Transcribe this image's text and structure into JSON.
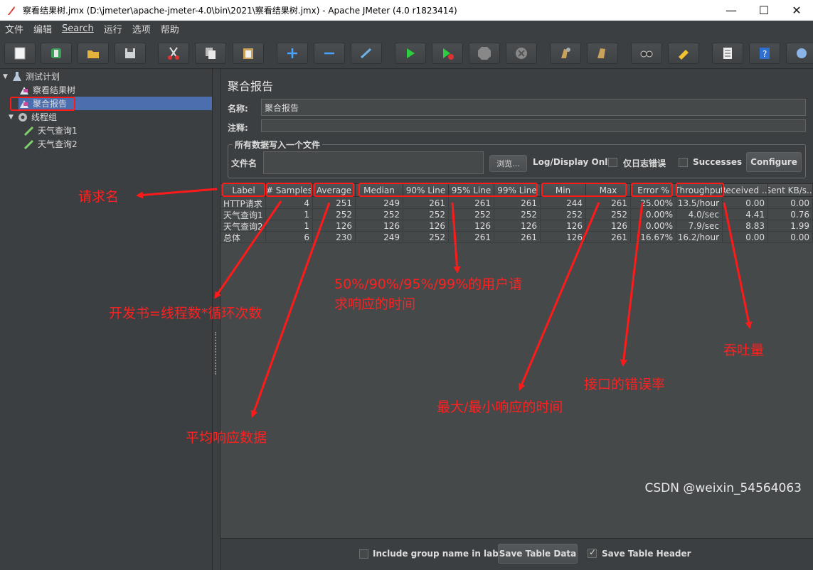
{
  "window": {
    "title": "察看结果树.jmx (D:\\jmeter\\apache-jmeter-4.0\\bin\\2021\\察看结果树.jmx) - Apache JMeter (4.0 r1823414)",
    "minimize": "—",
    "maximize": "☐",
    "close": "✕"
  },
  "menu": [
    "文件",
    "编辑",
    "Search",
    "运行",
    "选项",
    "帮助"
  ],
  "toolbar": [
    "new-icon",
    "template-icon",
    "open-icon",
    "save-icon",
    "cut-icon",
    "copy-icon",
    "paste-icon",
    "expand-icon",
    "collapse-icon",
    "toggle-icon",
    "start-icon",
    "start-no-pause-icon",
    "stop-icon",
    "shutdown-icon",
    "clear-icon",
    "clear-all-icon",
    "search-icon",
    "reset-search-icon",
    "function-helper-icon",
    "help-icon",
    "remote-icon"
  ],
  "tree": {
    "items": [
      {
        "label": "测试计划",
        "icon": "test-plan-icon"
      },
      {
        "label": "察看结果树",
        "icon": "listener-icon"
      },
      {
        "label": "聚合报告",
        "icon": "listener-icon"
      },
      {
        "label": "线程组",
        "icon": "gear-icon"
      },
      {
        "label": "天气查询1",
        "icon": "sampler-icon"
      },
      {
        "label": "天气查询2",
        "icon": "sampler-icon"
      }
    ]
  },
  "panel": {
    "title": "聚合报告",
    "name_label": "名称:",
    "name_value": "聚合报告",
    "comment_label": "注释:",
    "comment_value": "",
    "file_group_legend": "所有数据写入一个文件",
    "filename_label": "文件名",
    "filename_value": "",
    "browse_label": "浏览...",
    "log_display_label": "Log/Display Only:",
    "errors_only_label": "仅日志错误",
    "successes_label": "Successes",
    "configure_label": "Configure"
  },
  "table": {
    "headers": [
      "Label",
      "# Samples",
      "Average",
      "Median",
      "90% Line",
      "95% Line",
      "99% Line",
      "Min",
      "Max",
      "Error %",
      "Throughput",
      "Received ...",
      "Sent KB/s..."
    ],
    "rows": [
      [
        "HTTP请求",
        "4",
        "251",
        "249",
        "261",
        "261",
        "261",
        "244",
        "261",
        "25.00%",
        "13.5/hour",
        "0.00",
        "0.00"
      ],
      [
        "天气查询1",
        "1",
        "252",
        "252",
        "252",
        "252",
        "252",
        "252",
        "252",
        "0.00%",
        "4.0/sec",
        "4.41",
        "0.76"
      ],
      [
        "天气查询2",
        "1",
        "126",
        "126",
        "126",
        "126",
        "126",
        "126",
        "126",
        "0.00%",
        "7.9/sec",
        "8.83",
        "1.99"
      ],
      [
        "总体",
        "6",
        "230",
        "249",
        "252",
        "261",
        "261",
        "126",
        "261",
        "16.67%",
        "16.2/hour",
        "0.00",
        "0.00"
      ]
    ]
  },
  "bottom": {
    "include_group_label": "Include group name in label?",
    "save_table_data": "Save Table Data",
    "save_table_header": "Save Table Header"
  },
  "watermark": "CSDN @weixin_54564063",
  "annotations": {
    "request_name": "请求名",
    "samples_note": "开发书=线程数*循环次数",
    "average_note": "平均响应数据",
    "lines_note_1": "50%/90%/95%/99%的用户请",
    "lines_note_2": "求响应的时间",
    "minmax_note": "最大/最小响应的时间",
    "error_note": "接口的错误率",
    "throughput_note": "吞吐量"
  }
}
